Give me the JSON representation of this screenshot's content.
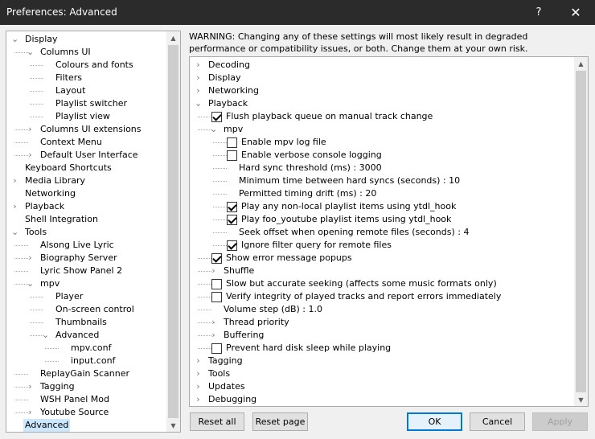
{
  "window": {
    "title": "Preferences: Advanced",
    "help_glyph": "?",
    "close_glyph": "✕"
  },
  "left_tree": [
    {
      "label": "Display",
      "depth": 0,
      "expander": "expanded"
    },
    {
      "label": "Columns UI",
      "depth": 1,
      "expander": "expanded"
    },
    {
      "label": "Colours and fonts",
      "depth": 2,
      "expander": "none"
    },
    {
      "label": "Filters",
      "depth": 2,
      "expander": "none"
    },
    {
      "label": "Layout",
      "depth": 2,
      "expander": "none"
    },
    {
      "label": "Playlist switcher",
      "depth": 2,
      "expander": "none"
    },
    {
      "label": "Playlist view",
      "depth": 2,
      "expander": "none"
    },
    {
      "label": "Columns UI extensions",
      "depth": 1,
      "expander": "collapsed"
    },
    {
      "label": "Context Menu",
      "depth": 1,
      "expander": "none"
    },
    {
      "label": "Default User Interface",
      "depth": 1,
      "expander": "collapsed"
    },
    {
      "label": "Keyboard Shortcuts",
      "depth": 0,
      "expander": "none"
    },
    {
      "label": "Media Library",
      "depth": 0,
      "expander": "collapsed"
    },
    {
      "label": "Networking",
      "depth": 0,
      "expander": "none"
    },
    {
      "label": "Playback",
      "depth": 0,
      "expander": "collapsed"
    },
    {
      "label": "Shell Integration",
      "depth": 0,
      "expander": "none"
    },
    {
      "label": "Tools",
      "depth": 0,
      "expander": "expanded"
    },
    {
      "label": "Alsong Live Lyric",
      "depth": 1,
      "expander": "none"
    },
    {
      "label": "Biography Server",
      "depth": 1,
      "expander": "collapsed"
    },
    {
      "label": "Lyric Show Panel 2",
      "depth": 1,
      "expander": "none"
    },
    {
      "label": "mpv",
      "depth": 1,
      "expander": "expanded"
    },
    {
      "label": "Player",
      "depth": 2,
      "expander": "none"
    },
    {
      "label": "On-screen control",
      "depth": 2,
      "expander": "none"
    },
    {
      "label": "Thumbnails",
      "depth": 2,
      "expander": "none"
    },
    {
      "label": "Advanced",
      "depth": 2,
      "expander": "expanded"
    },
    {
      "label": "mpv.conf",
      "depth": 3,
      "expander": "none"
    },
    {
      "label": "input.conf",
      "depth": 3,
      "expander": "none"
    },
    {
      "label": "ReplayGain Scanner",
      "depth": 1,
      "expander": "none"
    },
    {
      "label": "Tagging",
      "depth": 1,
      "expander": "collapsed"
    },
    {
      "label": "WSH Panel Mod",
      "depth": 1,
      "expander": "none"
    },
    {
      "label": "Youtube Source",
      "depth": 1,
      "expander": "collapsed"
    },
    {
      "label": "Advanced",
      "depth": 0,
      "expander": "none",
      "selected": true
    }
  ],
  "warning_text": "WARNING: Changing any of these settings will most likely result in degraded performance or compatibility issues, or both. Change them at your own risk.",
  "advanced_tree": [
    {
      "label": "Decoding",
      "depth": 0,
      "kind": "branch",
      "expander": "collapsed"
    },
    {
      "label": "Display",
      "depth": 0,
      "kind": "branch",
      "expander": "collapsed"
    },
    {
      "label": "Networking",
      "depth": 0,
      "kind": "branch",
      "expander": "collapsed"
    },
    {
      "label": "Playback",
      "depth": 0,
      "kind": "branch",
      "expander": "expanded"
    },
    {
      "label": "Flush playback queue on manual track change",
      "depth": 1,
      "kind": "checkbox",
      "checked": true
    },
    {
      "label": "mpv",
      "depth": 1,
      "kind": "branch",
      "expander": "expanded"
    },
    {
      "label": "Enable mpv log file",
      "depth": 2,
      "kind": "checkbox",
      "checked": false
    },
    {
      "label": "Enable verbose console logging",
      "depth": 2,
      "kind": "checkbox",
      "checked": false
    },
    {
      "label": "Hard sync threshold (ms) : 3000",
      "depth": 2,
      "kind": "value"
    },
    {
      "label": "Minimum time between hard syncs (seconds) : 10",
      "depth": 2,
      "kind": "value"
    },
    {
      "label": "Permitted timing drift (ms) : 20",
      "depth": 2,
      "kind": "value"
    },
    {
      "label": "Play any non-local playlist items using ytdl_hook",
      "depth": 2,
      "kind": "checkbox",
      "checked": true
    },
    {
      "label": "Play foo_youtube playlist items using ytdl_hook",
      "depth": 2,
      "kind": "checkbox",
      "checked": true
    },
    {
      "label": "Seek offset when opening remote files (seconds) : 4",
      "depth": 2,
      "kind": "value"
    },
    {
      "label": "Ignore filter query for remote files",
      "depth": 2,
      "kind": "checkbox",
      "checked": true
    },
    {
      "label": "Show error message popups",
      "depth": 1,
      "kind": "checkbox",
      "checked": true
    },
    {
      "label": "Shuffle",
      "depth": 1,
      "kind": "branch",
      "expander": "collapsed"
    },
    {
      "label": "Slow but accurate seeking (affects some music formats only)",
      "depth": 1,
      "kind": "checkbox",
      "checked": false
    },
    {
      "label": "Verify integrity of played tracks and report errors immediately",
      "depth": 1,
      "kind": "checkbox",
      "checked": false
    },
    {
      "label": "Volume step (dB) : 1.0",
      "depth": 1,
      "kind": "value"
    },
    {
      "label": "Thread priority",
      "depth": 1,
      "kind": "branch",
      "expander": "collapsed"
    },
    {
      "label": "Buffering",
      "depth": 1,
      "kind": "branch",
      "expander": "collapsed"
    },
    {
      "label": "Prevent hard disk sleep while playing",
      "depth": 1,
      "kind": "checkbox",
      "checked": false
    },
    {
      "label": "Tagging",
      "depth": 0,
      "kind": "branch",
      "expander": "collapsed"
    },
    {
      "label": "Tools",
      "depth": 0,
      "kind": "branch",
      "expander": "collapsed"
    },
    {
      "label": "Updates",
      "depth": 0,
      "kind": "branch",
      "expander": "collapsed"
    },
    {
      "label": "Debugging",
      "depth": 0,
      "kind": "branch",
      "expander": "collapsed"
    }
  ],
  "buttons": {
    "reset_all": "Reset all",
    "reset_page": "Reset page",
    "ok": "OK",
    "cancel": "Cancel",
    "apply": "Apply"
  },
  "icons": {
    "expanded": "expanded-chevron-icon",
    "collapsed": "collapsed-chevron-icon",
    "scroll_up": "scroll-up-arrow-icon",
    "scroll_down": "scroll-down-arrow-icon"
  },
  "colors": {
    "titlebar": "#2b2b2b",
    "selection": "#cce8ff",
    "default_button_border": "#0078d7",
    "dialog_bg": "#f0f0f0"
  }
}
